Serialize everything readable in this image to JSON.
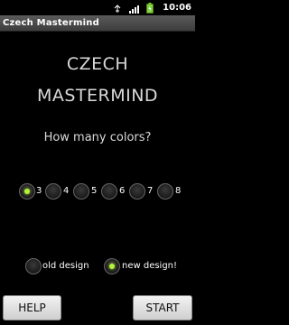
{
  "status_bar": {
    "time": "10:06"
  },
  "app": {
    "title": "Czech Mastermind"
  },
  "headline": {
    "line1": "CZECH",
    "line2": "MASTERMIND"
  },
  "question": "How many colors?",
  "color_options": [
    {
      "label": "3",
      "checked": true
    },
    {
      "label": "4",
      "checked": false
    },
    {
      "label": "5",
      "checked": false
    },
    {
      "label": "6",
      "checked": false
    },
    {
      "label": "7",
      "checked": false
    },
    {
      "label": "8",
      "checked": false
    }
  ],
  "design_options": [
    {
      "label": "old design",
      "checked": false
    },
    {
      "label": "new design!",
      "checked": true
    }
  ],
  "buttons": {
    "help": "HELP",
    "start": "START"
  },
  "colors": {
    "radio_selected": "#b5f23a",
    "title_bar": "#4a4a4a"
  }
}
